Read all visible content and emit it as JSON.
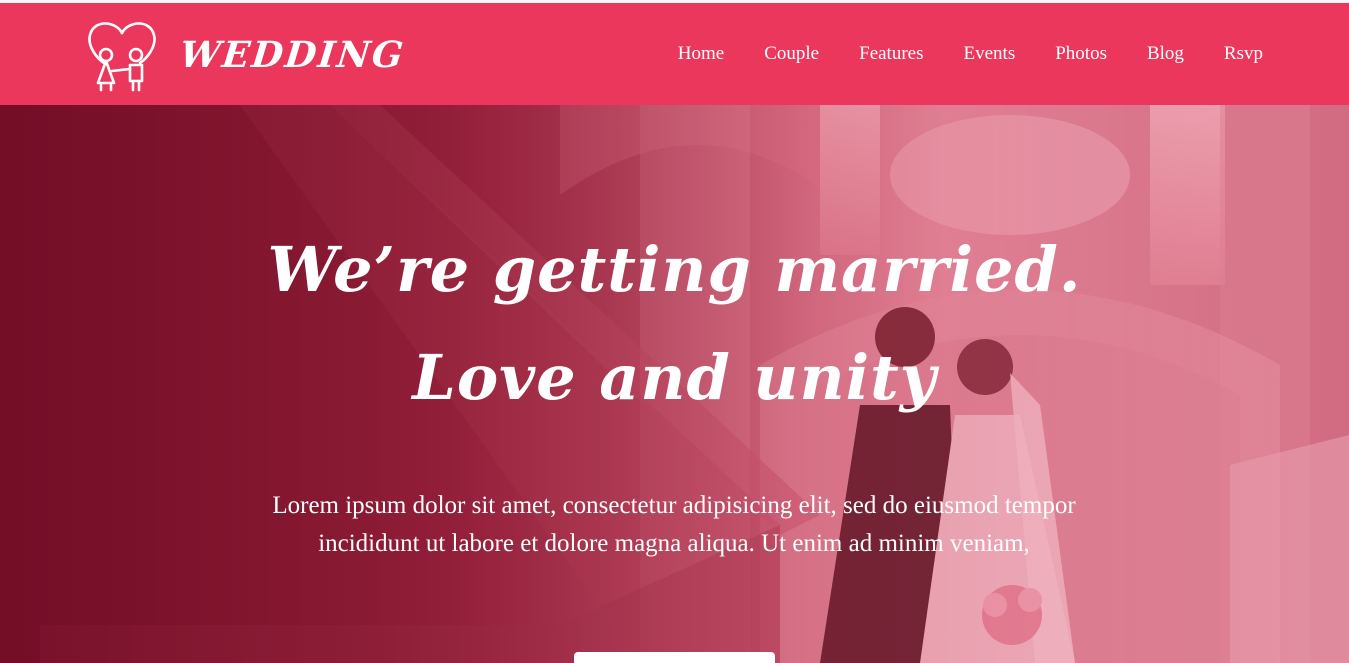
{
  "brand": {
    "name": "WEDDING",
    "logo_icon": "couple-heart-icon",
    "color": "#ec375d"
  },
  "nav": {
    "items": [
      {
        "label": "Home"
      },
      {
        "label": "Couple"
      },
      {
        "label": "Features"
      },
      {
        "label": "Events"
      },
      {
        "label": "Photos"
      },
      {
        "label": "Blog"
      },
      {
        "label": "Rsvp"
      }
    ]
  },
  "hero": {
    "title_line_1": "We’re getting married.",
    "title_line_2": "Love and unity",
    "description": "Lorem ipsum dolor sit amet, consectetur adipisicing elit, sed do eiusmod tempor incididunt ut labore et dolore magna aliqua. Ut enim ad minim veniam,",
    "overlay_color": "#8c1832"
  }
}
